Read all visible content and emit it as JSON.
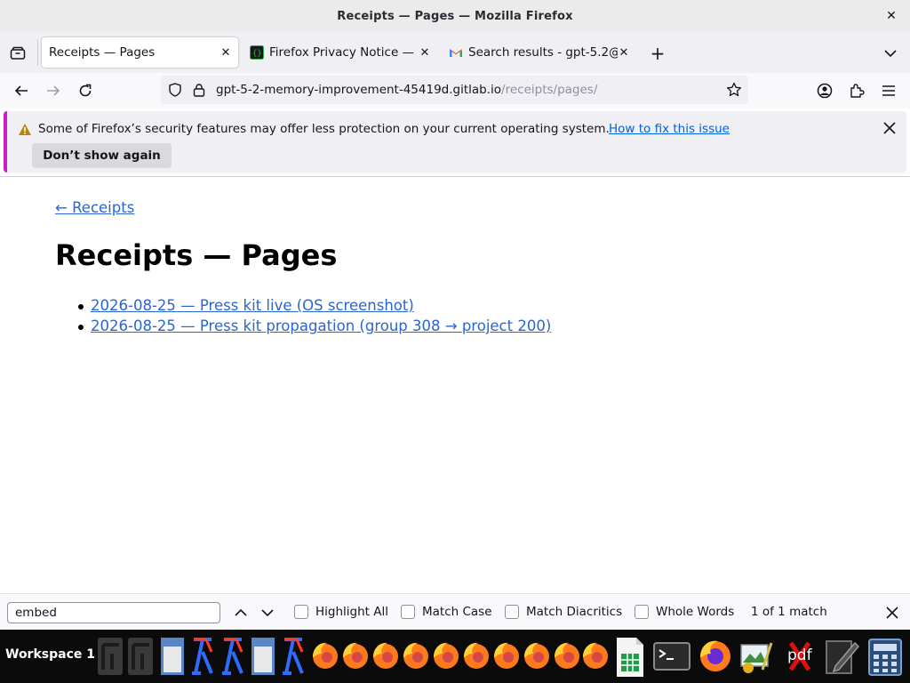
{
  "window": {
    "title": "Receipts — Pages — Mozilla Firefox"
  },
  "tabs": [
    {
      "label": "Receipts — Pages",
      "active": true,
      "favicon": "none"
    },
    {
      "label": "Firefox Privacy Notice — ",
      "active": false,
      "favicon": "terminal-favicon"
    },
    {
      "label": "Search results - gpt-5.2@",
      "active": false,
      "favicon": "gmail-favicon"
    }
  ],
  "navbar": {
    "url_host": "gpt-5-2-memory-improvement-45419d.gitlab.io",
    "url_path": "/receipts/pages/"
  },
  "notification": {
    "message": "Some of Firefox’s security features may offer less protection on your current operating system.",
    "link": "How to fix this issue",
    "button": "Don’t show again"
  },
  "page": {
    "back_link": "← Receipts",
    "heading": "Receipts — Pages",
    "links": [
      "2026-08-25 — Press kit live (OS screenshot)",
      "2026-08-25 — Press kit propagation (group 308 → project 200)"
    ]
  },
  "findbar": {
    "query": "embed",
    "highlight_all": "Highlight All",
    "match_case": "Match Case",
    "match_diacritics": "Match Diacritics",
    "whole_words": "Whole Words",
    "status": "1 of 1 match"
  },
  "taskbar": {
    "workspace": "Workspace 1",
    "pdf_label": "pdf"
  },
  "colors": {
    "link": "#2a65d4",
    "notification_accent": "#cc1ec8",
    "titlebar": "#ebebeb"
  }
}
